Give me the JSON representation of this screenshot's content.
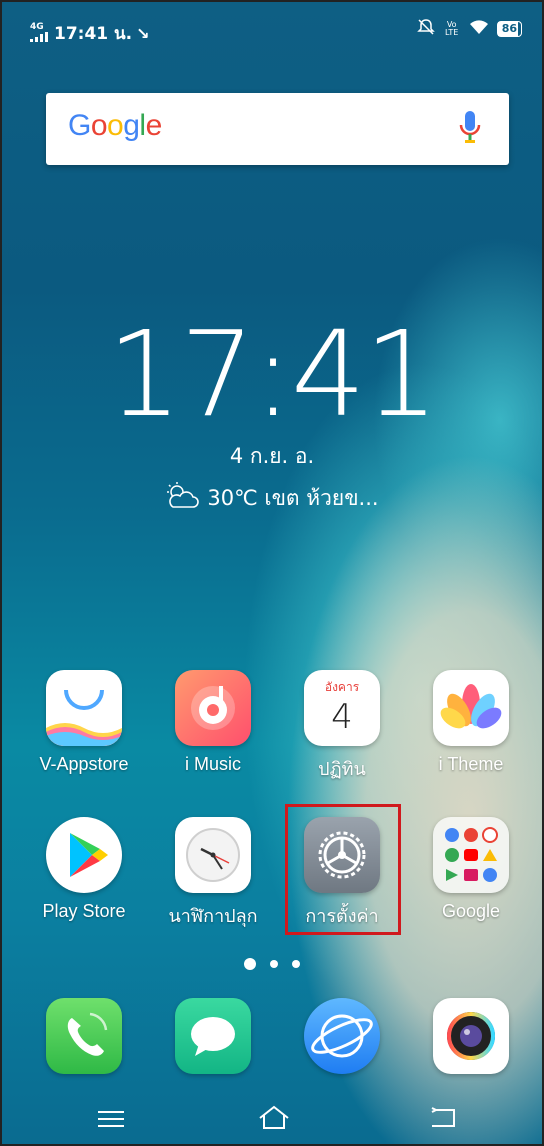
{
  "status_bar": {
    "network": "4G",
    "time": "17:41 น.",
    "battery": "86",
    "volte": "Vo LTE"
  },
  "search": {
    "logo": [
      "G",
      "o",
      "o",
      "g",
      "l",
      "e"
    ],
    "logo_colors": [
      "#4285F4",
      "#EA4335",
      "#FBBC05",
      "#4285F4",
      "#34A853",
      "#EA4335"
    ]
  },
  "clock": {
    "time": "17:41",
    "date": "4 ก.ย.  อ.",
    "weather": "30℃ เขต ห้วยข..."
  },
  "apps_row1": [
    {
      "label": "V-Appstore"
    },
    {
      "label": "i Music"
    },
    {
      "label": "ปฏิทิน",
      "calendar_day_name": "อังคาร",
      "calendar_day": "4"
    },
    {
      "label": "i Theme"
    }
  ],
  "apps_row2": [
    {
      "label": "Play Store"
    },
    {
      "label": "นาฬิกาปลุก"
    },
    {
      "label": "การตั้งค่า"
    },
    {
      "label": "Google"
    }
  ],
  "dock": [
    {
      "name": "phone-app"
    },
    {
      "name": "messages-app"
    },
    {
      "name": "browser-app"
    },
    {
      "name": "camera-app"
    }
  ],
  "colors": {
    "highlight": "#d0191d",
    "accent_red": "#e8403b"
  }
}
